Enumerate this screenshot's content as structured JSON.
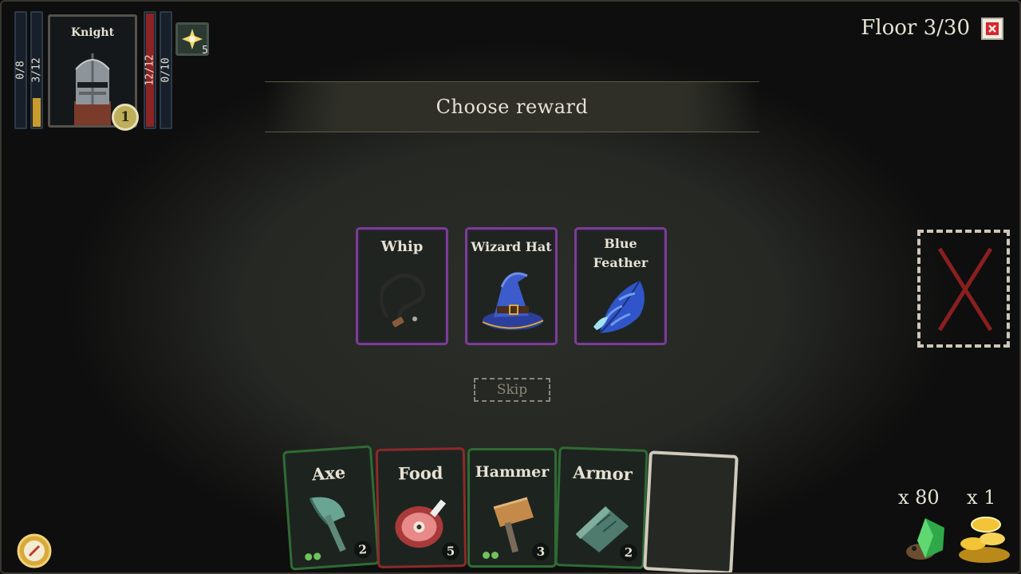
{
  "hero": {
    "name": "Knight",
    "level": "1",
    "bars": [
      {
        "label": "0/8",
        "fill": 0,
        "color": "#3a6db5"
      },
      {
        "label": "3/12",
        "fill": 0.25,
        "color": "#c79c2c"
      },
      {
        "label": "12/12",
        "fill": 1.0,
        "color": "#8c2424"
      },
      {
        "label": "0/10",
        "fill": 0,
        "color": "#3a6db5"
      }
    ],
    "buff_count": "5"
  },
  "floor": {
    "label": "Floor 3/30"
  },
  "banner": {
    "title": "Choose reward"
  },
  "rewards": [
    {
      "name": "Whip",
      "icon": "whip-icon"
    },
    {
      "name": "Wizard Hat",
      "icon": "wizard-hat-icon"
    },
    {
      "name_line1": "Blue",
      "name_line2": "Feather",
      "icon": "blue-feather-icon"
    }
  ],
  "skip_label": "Skip",
  "hand": [
    {
      "name": "Axe",
      "count": "2",
      "dots": 2,
      "icon": "axe-icon"
    },
    {
      "name": "Food",
      "count": "5",
      "dots": 0,
      "icon": "meat-icon"
    },
    {
      "name": "Hammer",
      "count": "3",
      "dots": 2,
      "icon": "hammer-icon"
    },
    {
      "name": "Armor",
      "count": "2",
      "dots": 0,
      "icon": "armor-icon"
    }
  ],
  "currency": {
    "gems": "x 80",
    "coins": "x 1"
  },
  "colors": {
    "reward_border": "#7a3f95",
    "weapon_border": "#2f6b33",
    "food_border": "#8c2a2a"
  }
}
